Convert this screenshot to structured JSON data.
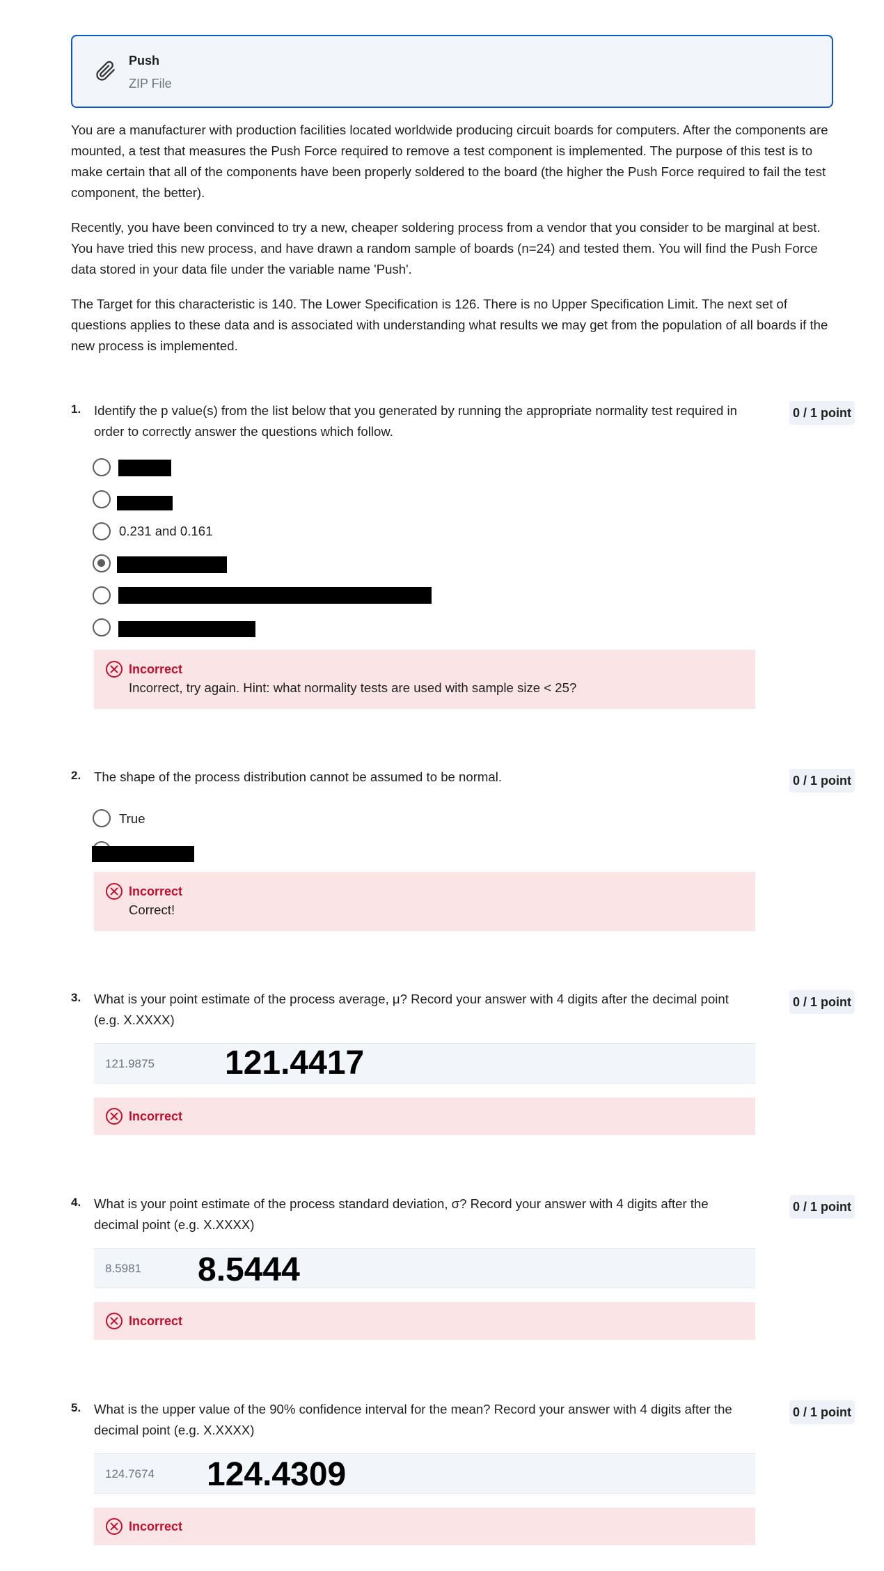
{
  "attachment": {
    "title": "Push",
    "subtitle": "ZIP File",
    "icon": "paperclip-icon"
  },
  "intro": [
    "You are a manufacturer with production facilities located worldwide producing circuit boards for computers. After the components are mounted, a test that measures the Push Force required to remove a test component is implemented. The purpose of this test is to make certain that all of the components have been properly soldered to the board (the higher the Push Force required to fail the test component, the better).",
    "Recently, you have been convinced to try a new, cheaper soldering process from a vendor that you consider to be marginal at best. You have tried this new process, and have drawn a random sample of boards (n=24) and tested them. You will find the Push Force data stored in your data file under the variable name 'Push'.",
    "The Target for this characteristic is 140. The Lower Specification is 126. There is no Upper Specification Limit. The next set of questions applies to these data and is associated with understanding what results we may get from the population of all boards if the new process is implemented."
  ],
  "questions": [
    {
      "number": "1.",
      "text": "Identify the p value(s) from the list below that you generated by running the appropriate normality test required in order to correctly answer the questions which follow.",
      "points": "0 / 1 point",
      "options": [
        "",
        "",
        "0.231 and 0.161",
        "",
        "",
        ""
      ],
      "selected_index": 3,
      "feedback": {
        "status": "Incorrect",
        "message": "Incorrect, try again. Hint: what normality tests are used with sample size < 25?"
      }
    },
    {
      "number": "2.",
      "text": "The shape of the process distribution cannot be assumed to be normal.",
      "points": "0 / 1 point",
      "options": [
        "True",
        ""
      ],
      "feedback": {
        "status": "Incorrect",
        "message": "Correct!"
      }
    },
    {
      "number": "3.",
      "text": "What is your point estimate of the process average, μ? Record your answer with 4 digits after the decimal point (e.g. X.XXXX)",
      "points": "0 / 1 point",
      "answer": "121.9875",
      "overlay": "121.4417",
      "feedback": {
        "status": "Incorrect"
      }
    },
    {
      "number": "4.",
      "text": "What is your point estimate of the process standard deviation, σ? Record your answer with 4 digits after the decimal point (e.g. X.XXXX)",
      "points": "0 / 1 point",
      "answer": "8.5981",
      "overlay": "8.5444",
      "feedback": {
        "status": "Incorrect"
      }
    },
    {
      "number": "5.",
      "text": "What is the upper value of the 90% confidence interval for the mean? Record your answer with 4 digits after the decimal point (e.g. X.XXXX)",
      "points": "0 / 1 point",
      "answer": "124.7674",
      "overlay": "124.4309",
      "feedback": {
        "status": "Incorrect"
      }
    }
  ],
  "colors": {
    "accent": "#0b56c9",
    "error": "#c0102d",
    "error_bg": "#fbe4e6",
    "points_bg": "#eef2f8"
  }
}
